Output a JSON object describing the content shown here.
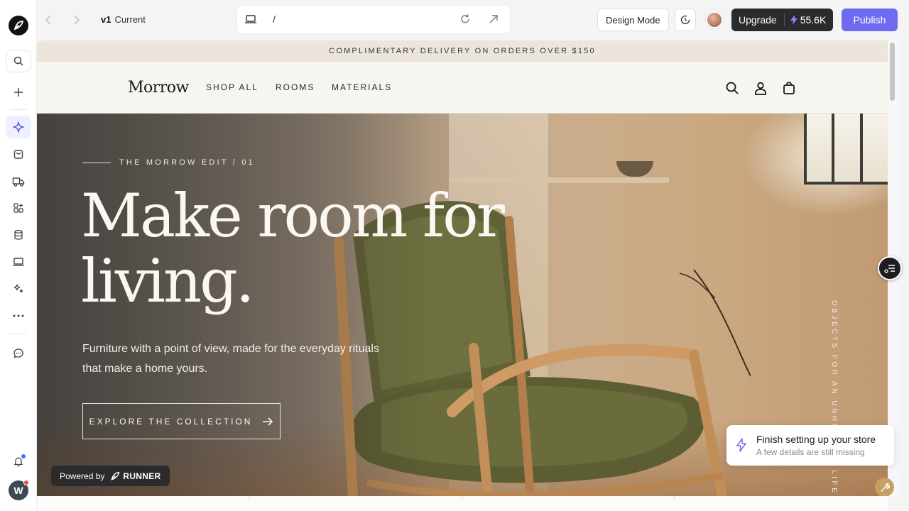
{
  "topbar": {
    "version_tag": "v1",
    "version_label": "Current",
    "url_path": "/",
    "design_mode_label": "Design Mode",
    "upgrade_label": "Upgrade",
    "credits": "55.6K",
    "publish_label": "Publish"
  },
  "rail": {
    "items": [
      "search-icon",
      "plus-icon",
      "sparkle-icon",
      "bag-icon",
      "truck-icon",
      "apps-icon",
      "database-icon",
      "laptop-icon",
      "magic-icon",
      "more-icon",
      "chat-icon"
    ],
    "notification_icon": "bell-icon",
    "user_initial": "W"
  },
  "store": {
    "announcement": "COMPLIMENTARY DELIVERY ON ORDERS OVER $150",
    "brand": "Morrow",
    "menu": [
      "SHOP ALL",
      "ROOMS",
      "MATERIALS"
    ],
    "hero": {
      "eyebrow": "THE MORROW EDIT / 01",
      "headline_line1": "Make room for",
      "headline_line2": "living.",
      "subtext": "Furniture with a point of view, made for the everyday rituals that make a home yours.",
      "cta_label": "EXPLORE THE COLLECTION",
      "vertical_text": "OBJECTS FOR AN UNHURRIED LIFE"
    }
  },
  "overlay": {
    "powered_by": "Powered by",
    "runner_label": "RUNNER",
    "toast_title": "Finish setting up your store",
    "toast_subtitle": "A few details are still missing"
  },
  "colors": {
    "accent": "#6e6bf0",
    "dark_button": "#2b2b2e",
    "announcement_bg": "#ebe5dc"
  }
}
